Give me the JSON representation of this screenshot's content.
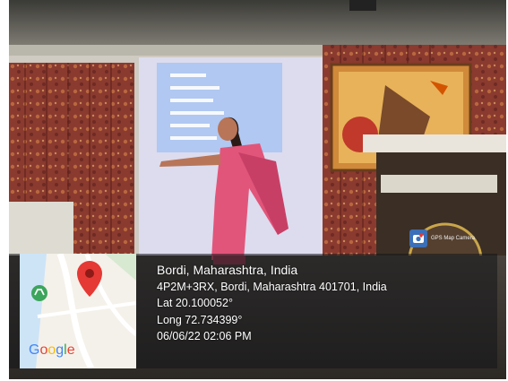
{
  "watermark": {
    "app_name": "GPS Map Camera",
    "logo_icon": "gps-map-camera-logo-icon"
  },
  "location": {
    "place": "Bordi, Maharashtra, India",
    "address": "4P2M+3RX, Bordi, Maharashtra 401701, India",
    "latitude": "Lat 20.100052°",
    "longitude": "Long 72.734399°",
    "datetime": "06/06/22 02:06 PM"
  },
  "map": {
    "provider_logo": "Google",
    "pin_icon": "map-pin-icon"
  },
  "colors": {
    "curtain": "#8a3a2e",
    "saree": "#e2557a",
    "screen": "#dcdcee",
    "pin": "#e53935"
  }
}
